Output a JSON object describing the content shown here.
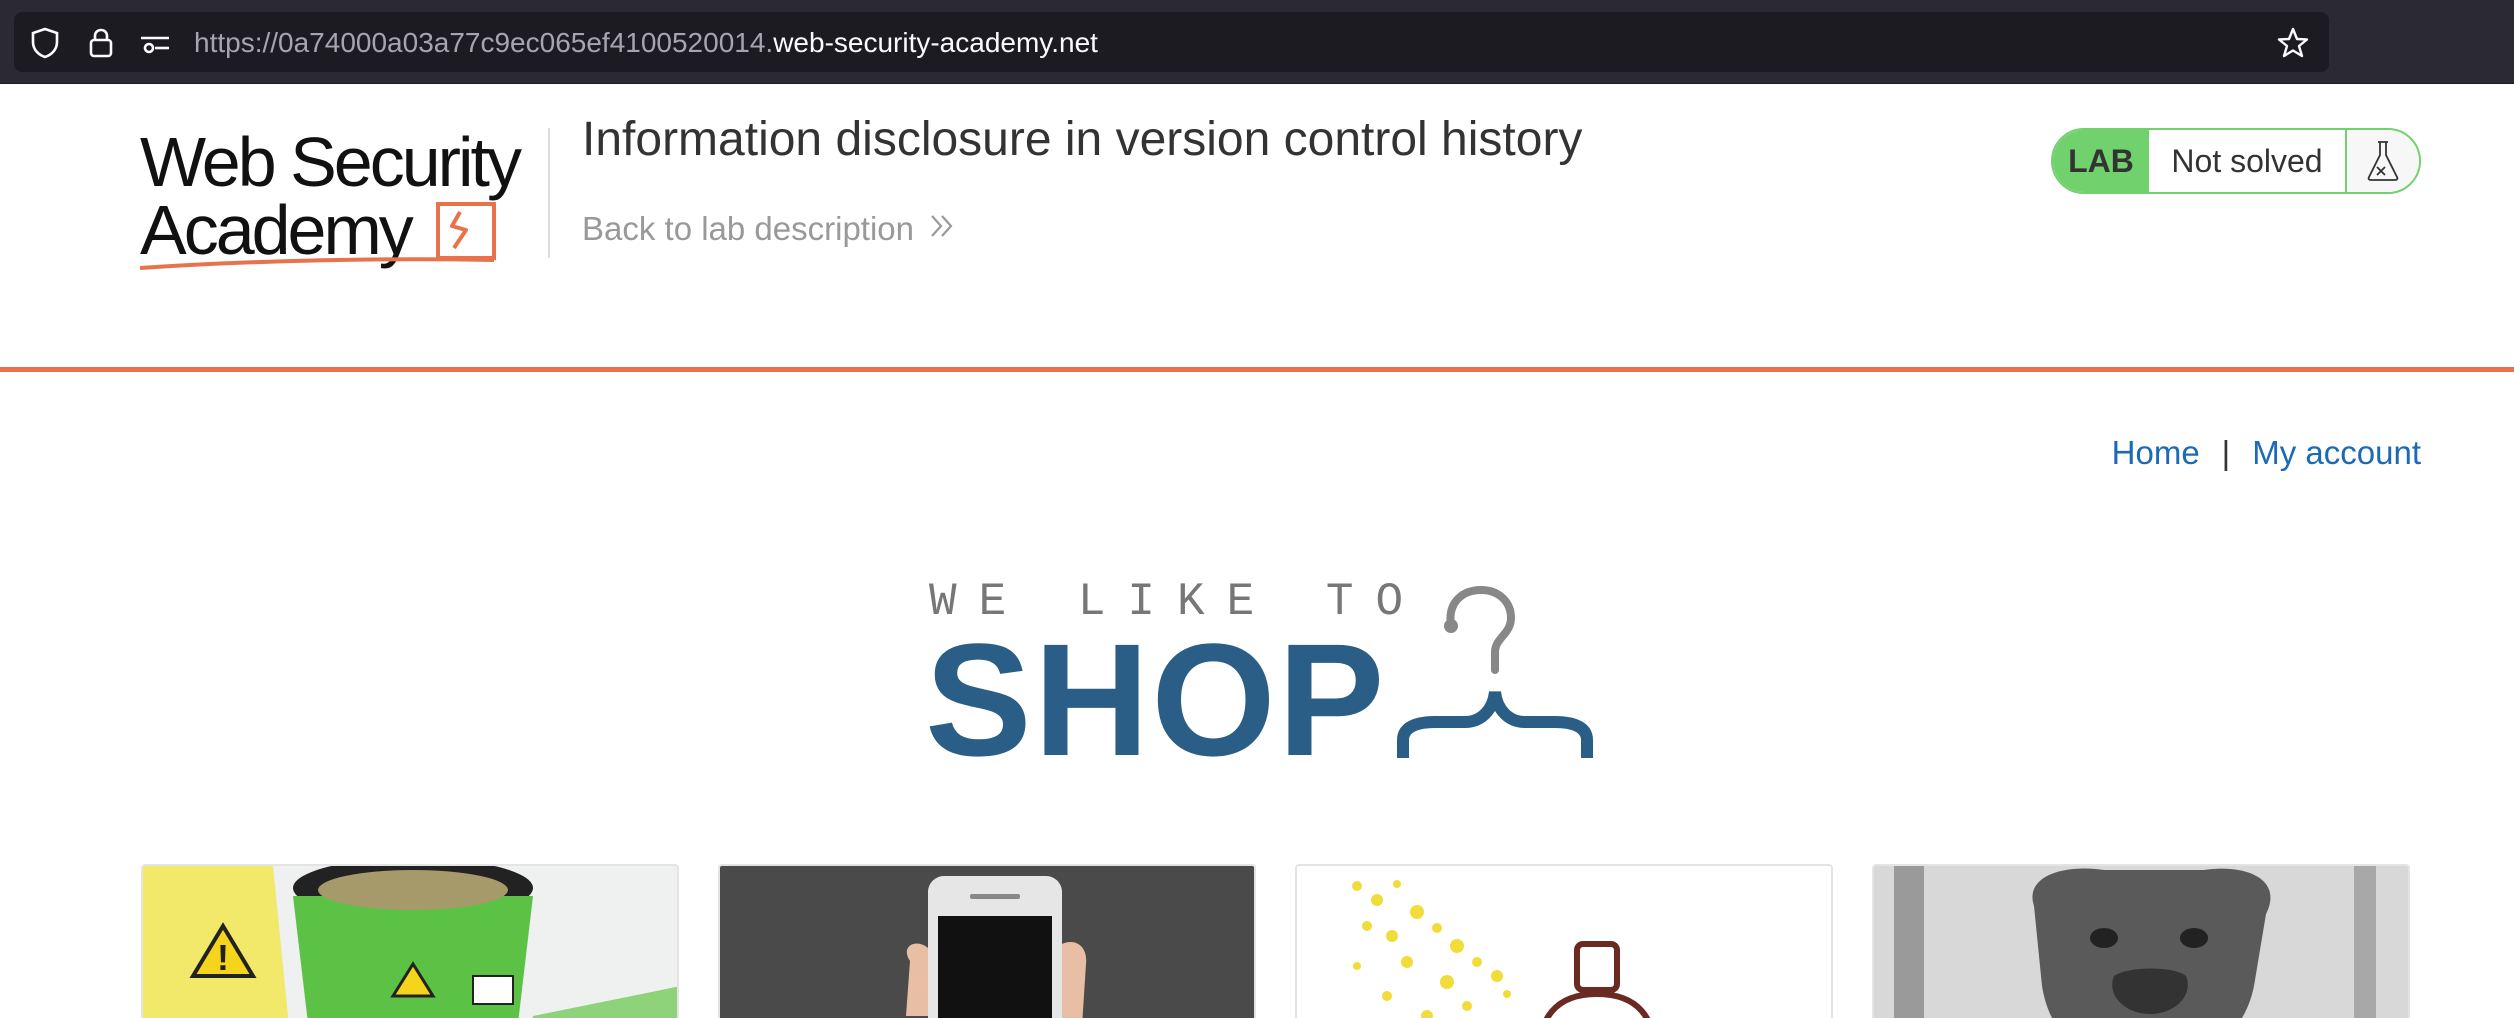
{
  "browser": {
    "url_prefix": "https://0a74000a03a77c9ec065ef4100520014.",
    "url_domain": "web-security-academy.net",
    "icons": [
      "shield-icon",
      "lock-icon",
      "site-settings-icon",
      "bookmark-star-icon"
    ]
  },
  "lab_header": {
    "logo_text_line1": "Web Security",
    "logo_text_line2": "Academy",
    "title": "Information disclosure in version control history",
    "back_link": "Back to lab description",
    "status": {
      "badge": "LAB",
      "text": "Not solved",
      "icon": "flask-icon"
    },
    "colors": {
      "accent": "#e8734a",
      "status_green": "#70d16d"
    }
  },
  "nav": {
    "home": "Home",
    "separator": "|",
    "my_account": "My account",
    "link_color": "#1c69b5"
  },
  "banner": {
    "tagline": "WE LIKE TO",
    "word": "SHOP",
    "icon": "hanger-icon",
    "brand_color": "#2a5e86"
  },
  "products": [
    {
      "image": "hazard-bucket-image"
    },
    {
      "image": "smartphone-hand-image"
    },
    {
      "image": "perfume-spray-image"
    },
    {
      "image": "bulldog-photo-image"
    }
  ]
}
